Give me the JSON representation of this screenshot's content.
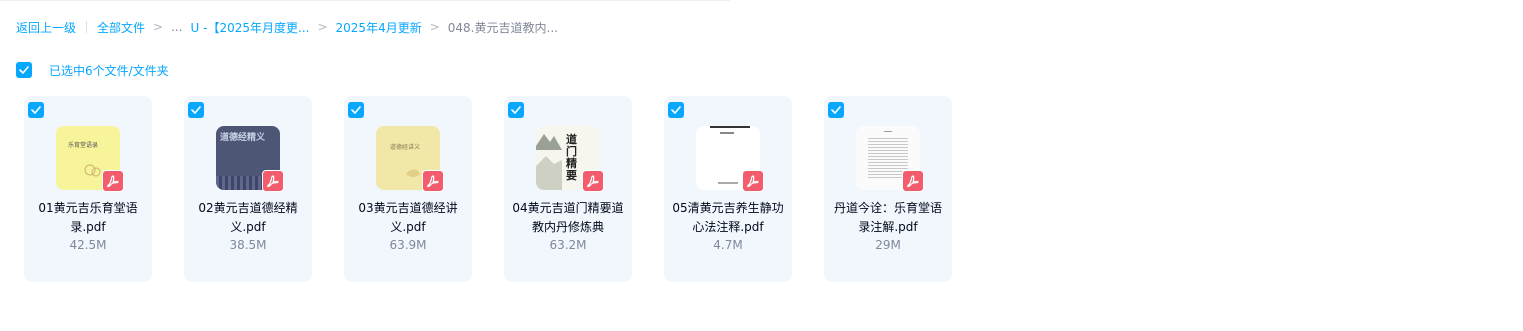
{
  "breadcrumb": {
    "back": "返回上一级",
    "all_files": "全部文件",
    "sep": ">",
    "ellipsis": "...",
    "level1": "U -【2025年月度更...",
    "level2": "2025年4月更新",
    "current": "048.黄元吉道教内..."
  },
  "selection": {
    "text": "已选中6个文件/文件夹",
    "checked": true
  },
  "colors": {
    "accent": "#06a7ff",
    "card_bg": "#f1f7fd",
    "pdf_badge": "#f35c6c"
  },
  "files": [
    {
      "name": "01黄元吉乐育堂语录.pdf",
      "size": "42.5M",
      "icon": "pdf-icon",
      "thumb_title": "乐育堂语录",
      "checked": true
    },
    {
      "name": "02黄元吉道德经精义.pdf",
      "size": "38.5M",
      "icon": "pdf-icon",
      "thumb_title": "道德经精义",
      "checked": true
    },
    {
      "name": "03黄元吉道德经讲义.pdf",
      "size": "63.9M",
      "icon": "pdf-icon",
      "thumb_title": "道德经讲义",
      "checked": true
    },
    {
      "name": "04黄元吉道门精要道教内丹修炼典",
      "size": "63.2M",
      "icon": "pdf-icon",
      "thumb_title": "道门精要",
      "checked": true
    },
    {
      "name": "05清黄元吉养生静功心法注释.pdf",
      "size": "4.7M",
      "icon": "pdf-icon",
      "thumb_title": "",
      "checked": true
    },
    {
      "name": "丹道今诠：乐育堂语录注解.pdf",
      "size": "29M",
      "icon": "pdf-icon",
      "thumb_title": "",
      "checked": true
    }
  ]
}
